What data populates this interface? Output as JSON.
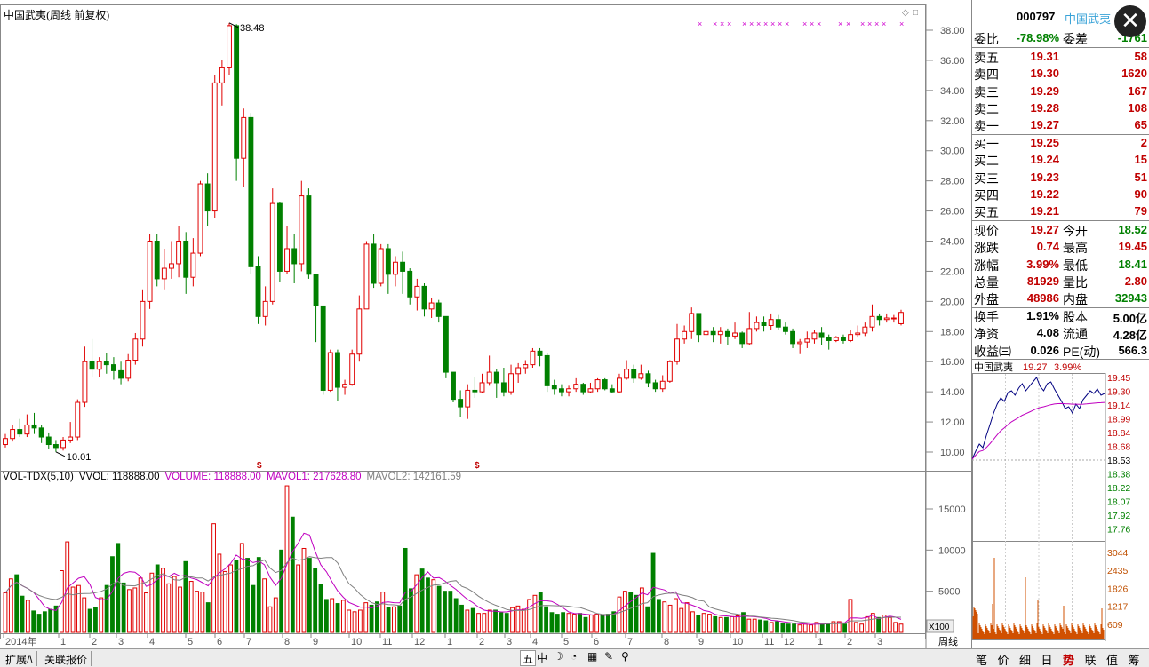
{
  "chart_title": "中国武夷(周线 前复权)",
  "kline": {
    "high_label": "38.48",
    "low_label": "10.01",
    "y_ticks": [
      "38.00",
      "36.00",
      "34.00",
      "32.00",
      "30.00",
      "28.00",
      "26.00",
      "24.00",
      "22.00",
      "20.00",
      "18.00",
      "16.00",
      "14.00",
      "12.00",
      "10.00"
    ],
    "x_labels": [
      "2014年",
      "1",
      "2",
      "3",
      "4",
      "5",
      "6",
      "7",
      "8",
      "9",
      "10",
      "11",
      "12",
      "1",
      "2",
      "3",
      "4",
      "5",
      "6",
      "7",
      "8",
      "9",
      "10",
      "11",
      "12",
      "1",
      "2",
      "3"
    ],
    "bottom_x_label": "周线",
    "candles": [
      [
        10.5,
        10.9,
        11.2,
        10.3
      ],
      [
        10.9,
        11.5,
        11.8,
        10.7
      ],
      [
        11.5,
        11.2,
        12.2,
        11.0
      ],
      [
        11.2,
        11.8,
        12.5,
        11.0
      ],
      [
        11.8,
        11.6,
        12.6,
        11.2
      ],
      [
        11.6,
        11.0,
        11.8,
        10.6
      ],
      [
        11.0,
        10.5,
        11.3,
        10.2
      ],
      [
        10.5,
        10.3,
        10.8,
        10.01
      ],
      [
        10.3,
        10.8,
        11.0,
        10.1
      ],
      [
        10.8,
        11.0,
        12.0,
        10.6
      ],
      [
        11.0,
        13.3,
        13.5,
        10.8
      ],
      [
        13.3,
        16.0,
        17.0,
        13.0
      ],
      [
        16.0,
        15.5,
        17.5,
        15.0
      ],
      [
        15.5,
        16.0,
        16.3,
        15.0
      ],
      [
        16.0,
        15.8,
        16.6,
        15.2
      ],
      [
        15.8,
        15.4,
        16.3,
        14.8
      ],
      [
        15.4,
        14.9,
        16.0,
        14.5
      ],
      [
        14.9,
        16.1,
        16.5,
        14.7
      ],
      [
        16.1,
        17.5,
        17.9,
        15.8
      ],
      [
        17.5,
        20.0,
        20.8,
        17.0
      ],
      [
        20.0,
        24.0,
        24.5,
        19.5
      ],
      [
        24.0,
        21.5,
        24.5,
        21.0
      ],
      [
        21.5,
        22.2,
        23.5,
        20.8
      ],
      [
        22.2,
        22.5,
        24.0,
        21.5
      ],
      [
        22.5,
        24.0,
        25.0,
        21.6
      ],
      [
        24.0,
        21.6,
        24.6,
        20.5
      ],
      [
        21.6,
        23.2,
        24.2,
        21.0
      ],
      [
        23.2,
        27.8,
        28.0,
        23.0
      ],
      [
        27.8,
        26.0,
        28.5,
        25.0
      ],
      [
        26.0,
        34.5,
        35.0,
        25.5
      ],
      [
        34.5,
        35.5,
        36.0,
        33.0
      ],
      [
        35.5,
        38.3,
        38.48,
        35.0
      ],
      [
        38.3,
        29.5,
        38.4,
        28.0
      ],
      [
        29.5,
        32.2,
        32.8,
        27.6
      ],
      [
        32.2,
        22.3,
        32.5,
        21.8
      ],
      [
        22.3,
        19.0,
        23.0,
        18.5
      ],
      [
        19.0,
        20.0,
        21.0,
        18.4
      ],
      [
        20.0,
        26.5,
        27.5,
        19.8
      ],
      [
        26.5,
        22.0,
        26.6,
        21.3
      ],
      [
        22.0,
        23.5,
        25.0,
        21.8
      ],
      [
        23.5,
        22.5,
        24.5,
        21.2
      ],
      [
        22.5,
        27.0,
        28.0,
        22.0
      ],
      [
        27.0,
        21.8,
        27.5,
        21.5
      ],
      [
        21.8,
        19.7,
        21.8,
        17.3
      ],
      [
        19.7,
        14.1,
        19.7,
        13.8
      ],
      [
        14.1,
        16.6,
        16.8,
        14.0
      ],
      [
        16.6,
        14.3,
        16.8,
        13.4
      ],
      [
        14.3,
        14.5,
        14.8,
        13.8
      ],
      [
        14.5,
        16.5,
        16.8,
        14.4
      ],
      [
        16.5,
        19.5,
        20.4,
        16.0
      ],
      [
        19.5,
        23.8,
        24.0,
        19.5
      ],
      [
        23.8,
        21.2,
        24.5,
        20.9
      ],
      [
        21.2,
        23.5,
        23.8,
        21.0
      ],
      [
        23.5,
        21.8,
        23.8,
        20.5
      ],
      [
        21.8,
        22.6,
        23.0,
        21.0
      ],
      [
        22.6,
        22.0,
        23.3,
        20.5
      ],
      [
        22.0,
        20.3,
        22.2,
        19.8
      ],
      [
        20.3,
        21.0,
        21.5,
        19.4
      ],
      [
        21.0,
        19.5,
        21.2,
        19.0
      ],
      [
        19.5,
        19.9,
        20.2,
        18.9
      ],
      [
        19.9,
        19.0,
        20.1,
        18.6
      ],
      [
        19.0,
        15.3,
        19.0,
        14.9
      ],
      [
        15.3,
        13.5,
        15.3,
        13.3
      ],
      [
        13.5,
        13.0,
        14.1,
        12.3
      ],
      [
        13.0,
        14.1,
        14.5,
        12.2
      ],
      [
        14.1,
        14.0,
        15.0,
        13.6
      ],
      [
        14.0,
        14.6,
        15.2,
        13.9
      ],
      [
        14.6,
        15.3,
        16.4,
        14.4
      ],
      [
        15.3,
        14.6,
        15.5,
        13.6
      ],
      [
        14.6,
        14.0,
        15.6,
        13.7
      ],
      [
        14.0,
        15.2,
        15.8,
        13.8
      ],
      [
        15.2,
        15.6,
        15.9,
        14.6
      ],
      [
        15.6,
        15.8,
        16.1,
        15.2
      ],
      [
        15.8,
        16.7,
        16.9,
        15.6
      ],
      [
        16.7,
        16.4,
        16.9,
        15.7
      ],
      [
        16.4,
        14.4,
        16.6,
        14.0
      ],
      [
        14.4,
        14.2,
        14.8,
        13.8
      ],
      [
        14.2,
        14.0,
        14.5,
        13.7
      ],
      [
        14.0,
        14.2,
        14.4,
        13.7
      ],
      [
        14.2,
        14.5,
        14.9,
        14.0
      ],
      [
        14.5,
        14.0,
        14.6,
        13.8
      ],
      [
        14.0,
        14.2,
        14.6,
        13.9
      ],
      [
        14.2,
        14.8,
        14.9,
        14.0
      ],
      [
        14.8,
        14.2,
        14.9,
        14.1
      ],
      [
        14.2,
        14.0,
        14.5,
        13.9
      ],
      [
        14.0,
        14.9,
        15.2,
        13.9
      ],
      [
        14.9,
        15.5,
        16.1,
        14.8
      ],
      [
        15.5,
        14.9,
        15.8,
        14.6
      ],
      [
        14.9,
        15.2,
        15.8,
        14.8
      ],
      [
        15.2,
        14.6,
        15.4,
        14.3
      ],
      [
        14.6,
        14.2,
        14.8,
        14.0
      ],
      [
        14.2,
        14.7,
        15.1,
        14.0
      ],
      [
        14.7,
        16.0,
        16.1,
        14.6
      ],
      [
        16.0,
        17.5,
        18.5,
        15.8
      ],
      [
        17.5,
        18.0,
        18.4,
        17.2
      ],
      [
        18.0,
        19.2,
        19.6,
        17.5
      ],
      [
        19.2,
        17.8,
        19.0,
        17.3
      ],
      [
        17.8,
        18.0,
        18.2,
        17.4
      ],
      [
        18.0,
        17.8,
        18.3,
        17.3
      ],
      [
        17.8,
        18.0,
        18.3,
        17.2
      ],
      [
        18.0,
        17.7,
        18.2,
        17.1
      ],
      [
        17.7,
        17.9,
        18.6,
        17.5
      ],
      [
        17.9,
        17.2,
        18.0,
        16.9
      ],
      [
        17.2,
        18.2,
        19.3,
        17.1
      ],
      [
        18.2,
        18.6,
        19.0,
        18.0
      ],
      [
        18.6,
        18.4,
        19.0,
        18.0
      ],
      [
        18.4,
        18.8,
        19.2,
        18.1
      ],
      [
        18.8,
        18.3,
        19.1,
        18.1
      ],
      [
        18.3,
        18.0,
        18.6,
        17.8
      ],
      [
        18.0,
        17.2,
        18.2,
        16.9
      ],
      [
        17.2,
        17.3,
        17.5,
        16.5
      ],
      [
        17.3,
        17.5,
        18.0,
        16.9
      ],
      [
        17.5,
        17.9,
        18.1,
        17.2
      ],
      [
        17.9,
        17.6,
        18.3,
        17.1
      ],
      [
        17.6,
        17.4,
        17.8,
        16.8
      ],
      [
        17.4,
        17.6,
        17.7,
        17.3
      ],
      [
        17.6,
        17.4,
        17.8,
        17.2
      ],
      [
        17.4,
        17.8,
        18.1,
        17.3
      ],
      [
        17.8,
        17.9,
        18.4,
        17.6
      ],
      [
        17.9,
        18.3,
        18.6,
        17.7
      ],
      [
        18.3,
        19.0,
        19.8,
        18.0
      ],
      [
        19.0,
        18.8,
        19.2,
        18.4
      ],
      [
        18.8,
        18.9,
        19.2,
        18.6
      ],
      [
        18.9,
        18.9,
        19.1,
        18.6
      ],
      [
        18.52,
        19.27,
        19.45,
        18.41
      ]
    ]
  },
  "volume": {
    "legend": {
      "name": "VOL-TDX(5,10)",
      "vol": "VVOL: 118888.00",
      "volume": "VOLUME: 118888.00",
      "mavol1": "MAVOL1: 217628.80",
      "mavol2": "MAVOL2: 142161.59"
    },
    "y_ticks": [
      "15000",
      "10000",
      "5000"
    ],
    "unit_label": "X100",
    "values": [
      4800,
      6500,
      7000,
      4400,
      3900,
      2600,
      2200,
      2500,
      2800,
      3200,
      7500,
      11000,
      5500,
      5700,
      4200,
      2800,
      3000,
      4200,
      5700,
      9200,
      10800,
      6000,
      5200,
      5400,
      6600,
      4800,
      7200,
      8200,
      7800,
      5900,
      6800,
      5500,
      8600,
      6200,
      5000,
      4900,
      3600,
      13200,
      9500,
      7400,
      8200,
      8700,
      10800,
      9000,
      5700,
      9100,
      6500,
      3100,
      4200,
      10000,
      17800,
      14000,
      8200,
      10200,
      9000,
      7800,
      5800,
      4000,
      4100,
      3500,
      3900,
      2700,
      2500,
      2700,
      3600,
      3300,
      3700,
      4900,
      3000,
      3100,
      3200,
      10200,
      5300,
      7000,
      7700,
      6600,
      6400,
      5600,
      5000,
      5000,
      4100,
      3300,
      2700,
      2900,
      2300,
      2300,
      2700,
      2700,
      2400,
      2300,
      3000,
      3200,
      2800,
      4000,
      4500,
      4800,
      3100,
      2400,
      2200,
      2400,
      2300,
      2200,
      2300,
      1800,
      2100,
      2200,
      2000,
      2200,
      2500,
      4300,
      5000,
      4800,
      4500,
      5400,
      3100,
      9600,
      4000,
      3700,
      3300,
      4100,
      2900,
      3600,
      2500,
      2000,
      2300,
      2200,
      1900,
      1800,
      1800,
      1900,
      2000,
      2400,
      1600,
      1600,
      1500,
      1400,
      1200,
      1300,
      1100,
      1000,
      1000,
      900,
      1000,
      900,
      1200,
      1000,
      1100,
      1300,
      1300,
      1000,
      4000,
      1200,
      1000,
      1900,
      2300,
      1800,
      2100,
      1800,
      1200,
      1000
    ]
  },
  "quote": {
    "code": "000797",
    "name": "中国武夷",
    "close_label": "✕",
    "weibi_label": "委比",
    "weibi": "-78.98%",
    "weicha_label": "委差",
    "weicha": "-1761",
    "sells": [
      {
        "label": "卖五",
        "price": "19.31",
        "vol": "58"
      },
      {
        "label": "卖四",
        "price": "19.30",
        "vol": "1620"
      },
      {
        "label": "卖三",
        "price": "19.29",
        "vol": "167"
      },
      {
        "label": "卖二",
        "price": "19.28",
        "vol": "108"
      },
      {
        "label": "卖一",
        "price": "19.27",
        "vol": "65"
      }
    ],
    "buys": [
      {
        "label": "买一",
        "price": "19.25",
        "vol": "2"
      },
      {
        "label": "买二",
        "price": "19.24",
        "vol": "15"
      },
      {
        "label": "买三",
        "price": "19.23",
        "vol": "51"
      },
      {
        "label": "买四",
        "price": "19.22",
        "vol": "90"
      },
      {
        "label": "买五",
        "price": "19.21",
        "vol": "79"
      }
    ],
    "stats": [
      {
        "l1": "现价",
        "v1": "19.27",
        "c1": "red",
        "l2": "今开",
        "v2": "18.52",
        "c2": "green"
      },
      {
        "l1": "涨跌",
        "v1": "0.74",
        "c1": "red",
        "l2": "最高",
        "v2": "19.45",
        "c2": "red"
      },
      {
        "l1": "涨幅",
        "v1": "3.99%",
        "c1": "red",
        "l2": "最低",
        "v2": "18.41",
        "c2": "green"
      },
      {
        "l1": "总量",
        "v1": "81929",
        "c1": "red",
        "l2": "量比",
        "v2": "2.80",
        "c2": "red"
      },
      {
        "l1": "外盘",
        "v1": "48986",
        "c1": "red",
        "l2": "内盘",
        "v2": "32943",
        "c2": "green"
      }
    ],
    "stats2": [
      {
        "l1": "换手",
        "v1": "1.91%",
        "l2": "股本",
        "v2": "5.00亿"
      },
      {
        "l1": "净资",
        "v1": "4.08",
        "l2": "流通",
        "v2": "4.28亿"
      },
      {
        "l1": "收益㈢",
        "v1": "0.026",
        "l2": "PE(动)",
        "v2": "566.3"
      }
    ]
  },
  "intraday": {
    "name": "中国武夷",
    "price": "19.27",
    "pct": "3.99%",
    "price_ticks_red": [
      "19.45",
      "19.30",
      "19.14",
      "18.99",
      "18.84",
      "18.68"
    ],
    "mid_tick": "18.53",
    "price_ticks_green": [
      "18.38",
      "18.22",
      "18.07",
      "17.92",
      "17.76"
    ],
    "vol_ticks": [
      "3044",
      "2435",
      "1826",
      "1217",
      "609"
    ]
  },
  "bottom": {
    "tabs": [
      "扩展/\\",
      "关联报价"
    ],
    "tools": [
      "五",
      "中",
      "☽",
      "◔",
      "▦",
      "✎",
      "⚲"
    ],
    "right_tabs": [
      "笔",
      "价",
      "细",
      "日",
      "势",
      "联",
      "值",
      "筹"
    ],
    "active_right": "势"
  },
  "colors": {
    "up": "#e00000",
    "down": "#008000",
    "mavol1": "#c000c0",
    "mavol2": "#808080",
    "price_line": "#000080",
    "avg_line": "#c000c0"
  }
}
